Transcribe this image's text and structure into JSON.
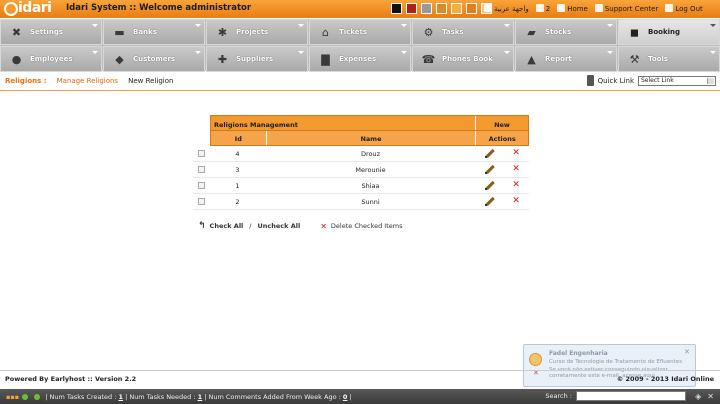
{
  "header": {
    "logo_text": "idari",
    "title": "Idari System :: Welcome administrator",
    "swatches": [
      "#111111",
      "#b01e16",
      "#9a9a9a",
      "#d98a2a",
      "#f2b13d",
      "#e57e1a",
      "#f4c77a"
    ],
    "arabic_label": "واجهة عربية",
    "count": "2",
    "home": "Home",
    "support": "Support Center",
    "logout": "Log Out"
  },
  "menu": [
    {
      "label": "Settings",
      "icon": "wrench-icon",
      "glyph": "✖"
    },
    {
      "label": "Banks",
      "icon": "bank-card-icon",
      "glyph": "▬"
    },
    {
      "label": "Projects",
      "icon": "gears-icon",
      "glyph": "✱"
    },
    {
      "label": "Tickets",
      "icon": "tag-icon",
      "glyph": "⌂"
    },
    {
      "label": "Tasks",
      "icon": "network-icon",
      "glyph": "⚙"
    },
    {
      "label": "Stocks",
      "icon": "truck-icon",
      "glyph": "▰"
    },
    {
      "label": "Booking",
      "icon": "booking-icon",
      "glyph": "◼"
    },
    {
      "label": "Employees",
      "icon": "employees-icon",
      "glyph": "●"
    },
    {
      "label": "Customers",
      "icon": "customers-icon",
      "glyph": "◆"
    },
    {
      "label": "Suppliers",
      "icon": "suppliers-icon",
      "glyph": "✚"
    },
    {
      "label": "Expenses",
      "icon": "briefcase-icon",
      "glyph": "▇"
    },
    {
      "label": "Phones Book",
      "icon": "phone-icon",
      "glyph": "☎"
    },
    {
      "label": "Report",
      "icon": "report-icon",
      "glyph": "▲"
    },
    {
      "label": "Tools",
      "icon": "tools-icon",
      "glyph": "⚒"
    }
  ],
  "subbar": {
    "title": "Religions :",
    "manage": "Manage Religions",
    "new_item": "New Religion",
    "quick_label": "Quick Link",
    "quick_value": "Select Link"
  },
  "table": {
    "title": "Religions Management",
    "new_label": "New",
    "col_id": "Id",
    "col_name": "Name",
    "col_actions": "Actions",
    "rows": [
      {
        "id": "4",
        "name": "Drouz"
      },
      {
        "id": "3",
        "name": "Merounie"
      },
      {
        "id": "1",
        "name": "Shiaa"
      },
      {
        "id": "2",
        "name": "Sunni"
      }
    ]
  },
  "tools": {
    "check_all": "Check All",
    "uncheck_all": "Uncheck All",
    "delete_checked": "Delete Checked Items"
  },
  "popup": {
    "title": "Fadel Engenharia",
    "line1": "Curso de Tecnologia de Tratamento de Efluentes",
    "line2": "Se você não estiver conseguindo visualizar corretamente este e-mail, acesse aqui"
  },
  "footer": {
    "powered": "Powered By Earlyhost",
    "version": "Version 2.2",
    "copyright": "© 2009 - 2013 Idari Online"
  },
  "statusbar": {
    "num_tasks_created_label": "Num Tasks Created :",
    "num_tasks_created": "1",
    "num_tasks_needed_label": "Num Tasks Needed :",
    "num_tasks_needed": "1",
    "num_comments_label": "Num Comments Added From Week Ago :",
    "num_comments": "0",
    "search_label": "Search :"
  }
}
